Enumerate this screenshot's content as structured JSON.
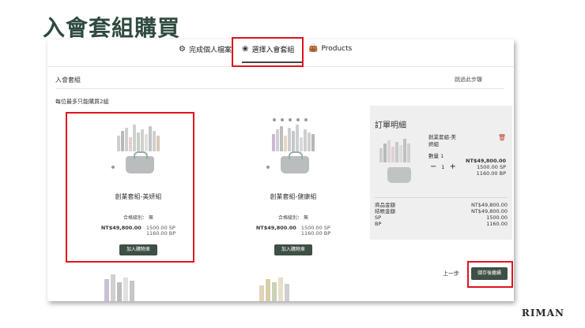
{
  "slide": {
    "title": "入會套組購買",
    "brand": "RIMAN"
  },
  "steps": [
    {
      "label": "完成個人檔案",
      "icon": "gear-icon"
    },
    {
      "label": "選擇入會套組",
      "icon": "products-icon"
    },
    {
      "label": "Products",
      "icon": "bag-icon"
    }
  ],
  "header": {
    "section_title": "入會套組",
    "skip_label": "跳過此步驟",
    "limit_note": "每位最多只能購買2組"
  },
  "products": [
    {
      "name": "創業套組-美妍組",
      "level": "合格級別： 無",
      "price": "NT$49,800.00",
      "sp": "1500.00 SP",
      "bp": "1160.00 BP",
      "add_label": "加入購物車"
    },
    {
      "name": "創業套組-健康組",
      "level": "合格級別： 無",
      "price": "NT$49,800.00",
      "sp": "1500.00 SP",
      "bp": "1160.00 BP",
      "add_label": "加入購物車"
    }
  ],
  "order": {
    "title": "訂單明細",
    "item_name": "創業套組-美妍組",
    "qty_label": "數量 1",
    "qty_value": "1",
    "item_price": "NT$49,800.00",
    "item_sp": "1500.00 SP",
    "item_bp": "1160.00 BP",
    "totals": [
      {
        "label": "商品金額",
        "value": "NT$49,800.00"
      },
      {
        "label": "結帳金額",
        "value": "NT$49,800.00"
      },
      {
        "label": "SP",
        "value": "1500.00"
      },
      {
        "label": "BP",
        "value": "1160.00"
      }
    ]
  },
  "footer": {
    "prev_label": "上一步",
    "save_label": "儲存後繼續"
  },
  "colors": {
    "title_green": "#2f4a3e",
    "button_green": "#3e4f45",
    "highlight_red": "#e0141e"
  }
}
